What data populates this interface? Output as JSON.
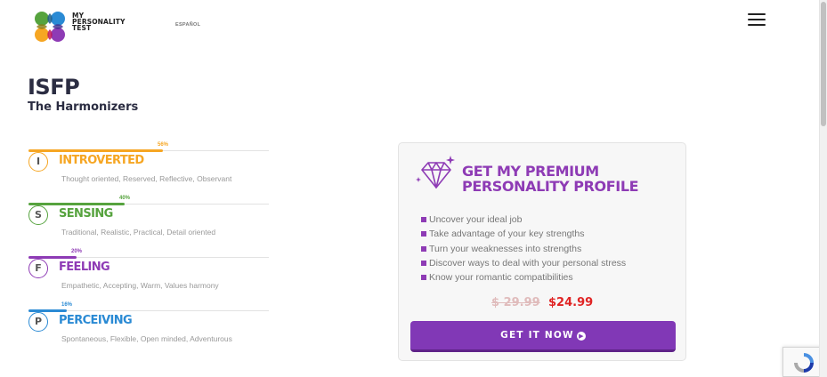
{
  "header": {
    "logo_text": [
      "MY",
      "PERSONALITY",
      "TEST"
    ],
    "language_link": "ESPAÑOL",
    "menu_icon": "hamburger-menu-icon"
  },
  "profile": {
    "type_code": "ISFP",
    "type_name": "The Harmonizers"
  },
  "traits": [
    {
      "letter": "I",
      "label": "INTROVERTED",
      "percent_label": "56%",
      "percent": 56,
      "description": "Thought oriented, Reserved, Reflective, Observant",
      "color": "#f6a623"
    },
    {
      "letter": "S",
      "label": "SENSING",
      "percent_label": "40%",
      "percent": 40,
      "description": "Traditional, Realistic, Practical, Detail oriented",
      "color": "#56a33e"
    },
    {
      "letter": "F",
      "label": "FEELING",
      "percent_label": "20%",
      "percent": 20,
      "description": "Empathetic, Accepting, Warm, Values harmony",
      "color": "#8e3bb5"
    },
    {
      "letter": "P",
      "label": "PERCEIVING",
      "percent_label": "16%",
      "percent": 16,
      "description": "Spontaneous, Flexible, Open minded, Adventurous",
      "color": "#2a8ad4"
    }
  ],
  "premium": {
    "icon": "diamond-icon",
    "title_line1": "GET MY PREMIUM",
    "title_line2": "PERSONALITY PROFILE",
    "features": [
      "Uncover your ideal job",
      "Take advantage of your key strengths",
      "Turn your weaknesses into strengths",
      "Discover ways to deal with your personal stress",
      "Know your romantic compatibilities"
    ],
    "old_price": "$ 29.99",
    "new_price": "$24.99",
    "cta_label": "GET IT NOW"
  },
  "colors": {
    "accent_purple": "#8138b6",
    "price_red": "#e02424",
    "heading_dark": "#2b2d42"
  }
}
